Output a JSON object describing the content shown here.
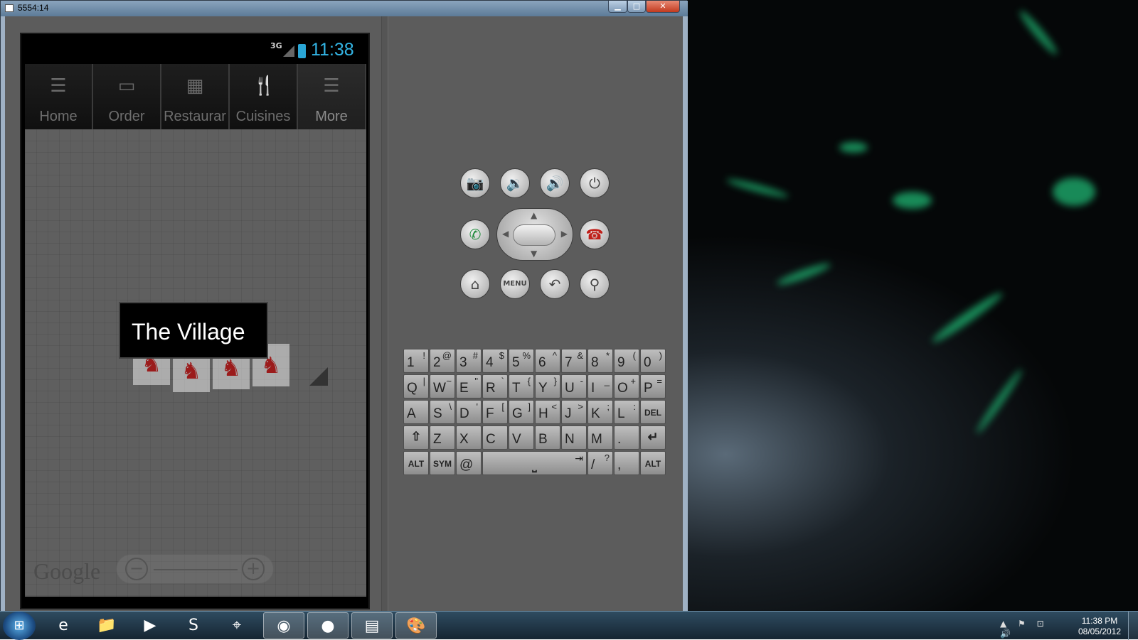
{
  "window": {
    "title": "5554:14",
    "buttons": {
      "minimize": "▁",
      "maximize": "□",
      "close": "✕"
    }
  },
  "statusbar": {
    "network": "3G",
    "time": "11:38"
  },
  "tabs": [
    {
      "label": "Home",
      "icon": "list-icon"
    },
    {
      "label": "Order",
      "icon": "card-icon"
    },
    {
      "label": "Restaurar",
      "icon": "calendar-icon"
    },
    {
      "label": "Cuisines",
      "icon": "fork-knife-icon"
    },
    {
      "label": "More",
      "icon": "list-icon",
      "selected": true
    }
  ],
  "map": {
    "balloon_title": "The Village",
    "attribution": "Google",
    "zoom_out": "−",
    "zoom_in": "+"
  },
  "controls": {
    "camera": "📷",
    "vol_down": "🔉",
    "vol_up": "🔊",
    "power": "⏻",
    "call": "✆",
    "end_call": "☎",
    "home": "⌂",
    "menu": "MENU",
    "back": "↶",
    "search": "⚲"
  },
  "keyboard": {
    "rows": [
      [
        [
          "1",
          "!"
        ],
        [
          "2",
          "@"
        ],
        [
          "3",
          "#"
        ],
        [
          "4",
          "$"
        ],
        [
          "5",
          "%"
        ],
        [
          "6",
          "^"
        ],
        [
          "7",
          "&"
        ],
        [
          "8",
          "*"
        ],
        [
          "9",
          "("
        ],
        [
          "0",
          ")"
        ]
      ],
      [
        [
          "Q",
          "|"
        ],
        [
          "W",
          "~"
        ],
        [
          "E",
          "\""
        ],
        [
          "R",
          "`"
        ],
        [
          "T",
          "{"
        ],
        [
          "Y",
          "}"
        ],
        [
          "U",
          "-"
        ],
        [
          "I",
          "_"
        ],
        [
          "O",
          "+"
        ],
        [
          "P",
          "="
        ]
      ],
      [
        [
          "A",
          ""
        ],
        [
          "S",
          "\\"
        ],
        [
          "D",
          "'"
        ],
        [
          "F",
          "["
        ],
        [
          "G",
          "]"
        ],
        [
          "H",
          "<"
        ],
        [
          "J",
          ">"
        ],
        [
          "K",
          ";"
        ],
        [
          "L",
          ":"
        ],
        [
          "DEL",
          ""
        ]
      ],
      [
        [
          "⇧",
          ""
        ],
        [
          "Z",
          ""
        ],
        [
          "X",
          ""
        ],
        [
          "C",
          ""
        ],
        [
          "V",
          ""
        ],
        [
          "B",
          ""
        ],
        [
          "N",
          ""
        ],
        [
          "M",
          ""
        ],
        [
          ".",
          ""
        ],
        [
          "↵",
          ""
        ]
      ]
    ],
    "bottom": {
      "alt": "ALT",
      "sym": "SYM",
      "at": "@",
      "space": "⎵",
      "tab": "⇥",
      "slash": "/",
      "question": "?",
      "comma": ","
    }
  },
  "taskbar": {
    "start": "⊞",
    "apps": [
      "e",
      "📁",
      "▶",
      "S",
      "⌖",
      "◉",
      "●",
      "▤",
      "🎨"
    ],
    "tray_icons": "▲ ⚑ ⊡ 🔊",
    "time": "11:38 PM",
    "date": "08/05/2012"
  }
}
